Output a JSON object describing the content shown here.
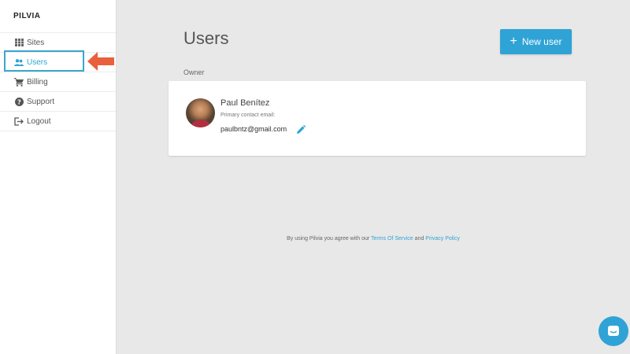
{
  "brand": "PILVIA",
  "sidebar": {
    "items": [
      {
        "label": "Sites",
        "icon": "grid-icon"
      },
      {
        "label": "Users",
        "icon": "users-icon",
        "active": true
      },
      {
        "label": "Billing",
        "icon": "cart-icon"
      },
      {
        "label": "Support",
        "icon": "help-icon"
      },
      {
        "label": "Logout",
        "icon": "logout-icon"
      }
    ]
  },
  "main": {
    "title": "Users",
    "new_user_label": "New user",
    "section_label": "Owner",
    "owner": {
      "name": "Paul Benítez",
      "contact_label": "Primary contact email:",
      "email": "paulbntz@gmail.com"
    }
  },
  "footer": {
    "prefix": "By using Pilvia you agree with our",
    "terms": "Terms Of Service",
    "and": "and",
    "privacy": "Privacy Policy"
  },
  "colors": {
    "accent": "#2fa3d6",
    "annotation_arrow": "#e8603c",
    "background": "#e8e8e8"
  }
}
